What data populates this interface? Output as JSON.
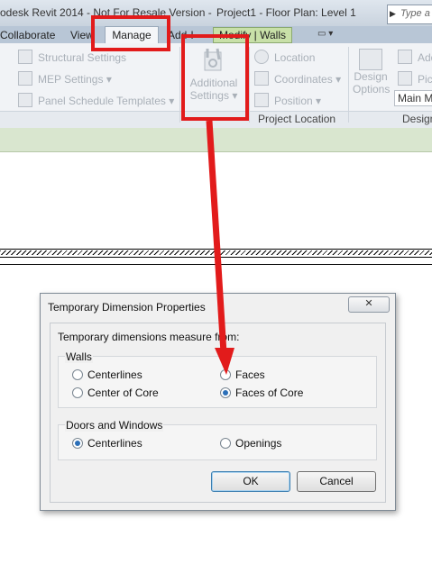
{
  "window": {
    "title_left": "odesk Revit 2014 - Not For Resale Version -",
    "title_right": "Project1 - Floor Plan: Level 1",
    "search_placeholder": "Type a"
  },
  "ribbon_tabs": {
    "collaborate": "Collaborate",
    "view": "View",
    "manage": "Manage",
    "addins": "Add-I",
    "modify": "Modify | Walls",
    "extra": "▭ ▾"
  },
  "ribbon": {
    "structural_settings": "Structural Settings",
    "mep_settings": "MEP Settings",
    "panel_schedule_templates": "Panel Schedule Templates",
    "additional_settings_line1": "Additional",
    "additional_settings_line2": "Settings",
    "location": "Location",
    "coordinates": "Coordinates",
    "position": "Position",
    "design_options_line1": "Design",
    "design_options_line2": "Options",
    "add": "Add",
    "pick": "Pick",
    "main_model": "Main M",
    "panel_project_location": "Project Location",
    "panel_design": "Design"
  },
  "dialog": {
    "title": "Temporary Dimension Properties",
    "close_glyph": "✕",
    "prompt": "Temporary dimensions measure from:",
    "walls_group": "Walls",
    "walls_centerlines": "Centerlines",
    "walls_faces": "Faces",
    "walls_center_of_core": "Center of Core",
    "walls_faces_of_core": "Faces of Core",
    "doors_group": "Doors and Windows",
    "doors_centerlines": "Centerlines",
    "doors_openings": "Openings",
    "ok": "OK",
    "cancel": "Cancel"
  },
  "colors": {
    "highlight": "#e21b1b",
    "modify_tab": "#c8e0a8"
  }
}
